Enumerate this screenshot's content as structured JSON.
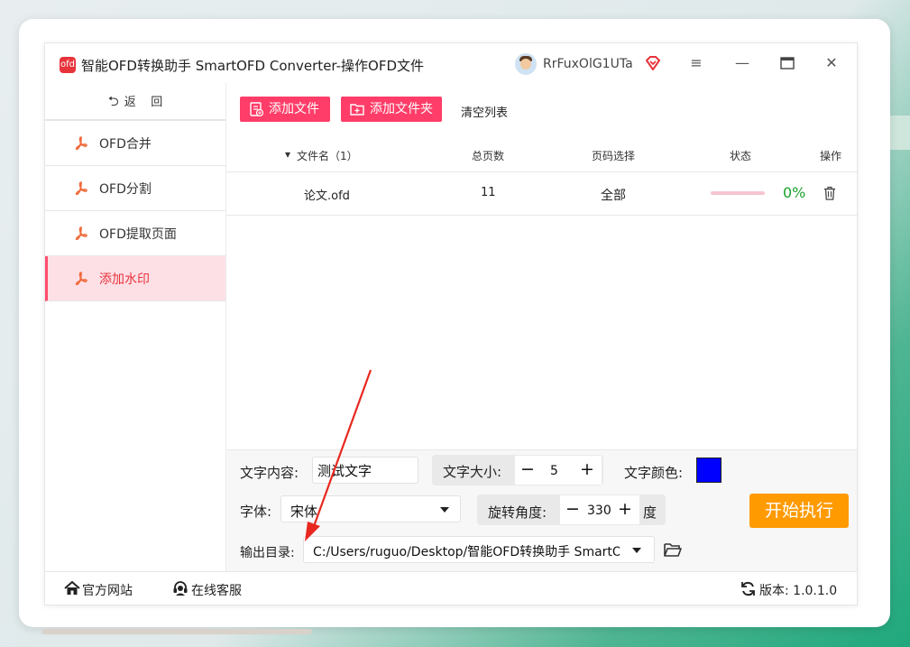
{
  "app": {
    "title": "智能OFD转换助手 SmartOFD Converter-操作OFD文件",
    "username": "RrFuxOlG1UTa",
    "logo_text": "ofd"
  },
  "window_controls": {
    "menu": "≡",
    "minimize": "—",
    "maximize": "☐",
    "close": "✕"
  },
  "sidebar": {
    "back_label": "返    回",
    "items": [
      {
        "label": "OFD合并",
        "active": false
      },
      {
        "label": "OFD分割",
        "active": false
      },
      {
        "label": "OFD提取页面",
        "active": false
      },
      {
        "label": "添加水印",
        "active": true
      }
    ]
  },
  "toolbar": {
    "add_file": "添加文件",
    "add_folder": "添加文件夹",
    "clear_list": "清空列表"
  },
  "table": {
    "headers": {
      "filename": "文件名（1）",
      "pages": "总页数",
      "page_select": "页码选择",
      "status": "状态",
      "action": "操作"
    },
    "rows": [
      {
        "filename": "论文.ofd",
        "pages": "11",
        "page_select": "全部",
        "progress": "0%"
      }
    ]
  },
  "settings": {
    "text_content_label": "文字内容:",
    "text_content_value": "测试文字",
    "font_size_label": "文字大小:",
    "font_size_value": "5",
    "font_color_label": "文字颜色:",
    "font_color": "#0000ff",
    "font_label": "字体:",
    "font_value": "宋体",
    "rotation_label": "旋转角度:",
    "rotation_value": "330",
    "rotation_unit": "度",
    "output_label": "输出目录:",
    "output_value": "C:/Users/ruguo/Desktop/智能OFD转换助手 SmartOf",
    "start_button": "开始执行"
  },
  "statusbar": {
    "website": "官方网站",
    "support": "在线客服",
    "version": "版本: 1.0.1.0"
  },
  "colors": {
    "accent": "#ff3d68",
    "start": "#ff9a00",
    "success": "#1aa12a",
    "annotation": "#e8281f"
  }
}
